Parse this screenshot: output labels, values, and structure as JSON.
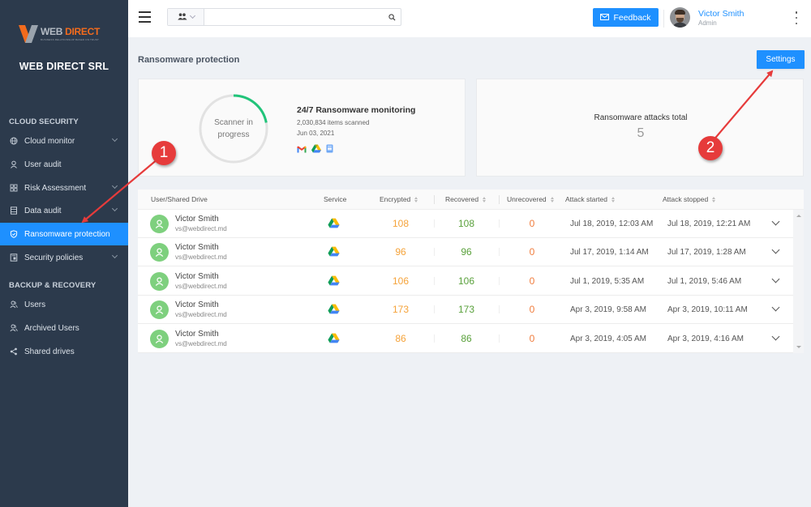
{
  "sidebar": {
    "logo": {
      "word1": "WEB ",
      "word2": "DIRECT",
      "tagline": "BUSINESS RELATIONSHIP BASED ON TRUST"
    },
    "company": "WEB DIRECT SRL",
    "sections": [
      {
        "title": "CLOUD SECURITY",
        "items": [
          {
            "label": "Cloud monitor",
            "icon": "globe-icon",
            "has_children": true
          },
          {
            "label": "User audit",
            "icon": "user-icon",
            "has_children": false
          },
          {
            "label": "Risk Assessment",
            "icon": "grid-icon",
            "has_children": true
          },
          {
            "label": "Data audit",
            "icon": "database-icon",
            "has_children": true
          },
          {
            "label": "Ransomware protection",
            "icon": "shield-icon",
            "has_children": false,
            "active": true
          },
          {
            "label": "Security policies",
            "icon": "policy-icon",
            "has_children": true
          }
        ]
      },
      {
        "title": "BACKUP & RECOVERY",
        "items": [
          {
            "label": "Users",
            "icon": "users-icon",
            "has_children": false
          },
          {
            "label": "Archived Users",
            "icon": "archived-users-icon",
            "has_children": false
          },
          {
            "label": "Shared drives",
            "icon": "share-icon",
            "has_children": false
          }
        ]
      }
    ]
  },
  "topbar": {
    "search": {
      "value": "",
      "placeholder": ""
    },
    "feedback_label": "Feedback",
    "user": {
      "name": "Victor Smith",
      "role": "Admin"
    }
  },
  "page": {
    "title": "Ransomware protection",
    "settings_label": "Settings"
  },
  "scanner": {
    "status": "Scanner in progress",
    "progress_percent": 22,
    "title": "24/7 Ransomware monitoring",
    "items_scanned": "2,030,834 items scanned",
    "date": "Jun 03, 2021",
    "services": [
      "gmail-icon",
      "google-drive-icon",
      "google-sites-icon"
    ]
  },
  "attacks": {
    "label": "Ransomware attacks total",
    "value": "5"
  },
  "table": {
    "columns": [
      "User/Shared Drive",
      "Service",
      "Encrypted",
      "Recovered",
      "Unrecovered",
      "Attack started",
      "Attack stopped"
    ],
    "rows": [
      {
        "name": "Victor Smith",
        "email": "vs@webdirect.md",
        "service": "google-drive",
        "encrypted": "108",
        "recovered": "108",
        "unrecovered": "0",
        "started": "Jul 18, 2019, 12:03 AM",
        "stopped": "Jul 18, 2019, 12:21 AM"
      },
      {
        "name": "Victor Smith",
        "email": "vs@webdirect.md",
        "service": "google-drive",
        "encrypted": "96",
        "recovered": "96",
        "unrecovered": "0",
        "started": "Jul 17, 2019, 1:14 AM",
        "stopped": "Jul 17, 2019, 1:28 AM"
      },
      {
        "name": "Victor Smith",
        "email": "vs@webdirect.md",
        "service": "google-drive",
        "encrypted": "106",
        "recovered": "106",
        "unrecovered": "0",
        "started": "Jul 1, 2019, 5:35 AM",
        "stopped": "Jul 1, 2019, 5:46 AM"
      },
      {
        "name": "Victor Smith",
        "email": "vs@webdirect.md",
        "service": "google-drive",
        "encrypted": "173",
        "recovered": "173",
        "unrecovered": "0",
        "started": "Apr 3, 2019, 9:58 AM",
        "stopped": "Apr 3, 2019, 10:11 AM"
      },
      {
        "name": "Victor Smith",
        "email": "vs@webdirect.md",
        "service": "google-drive",
        "encrypted": "86",
        "recovered": "86",
        "unrecovered": "0",
        "started": "Apr 3, 2019, 4:05 AM",
        "stopped": "Apr 3, 2019, 4:16 AM"
      }
    ]
  },
  "annotations": [
    {
      "label": "1",
      "target": "Ransomware protection menu item"
    },
    {
      "label": "2",
      "target": "Settings button"
    }
  ],
  "colors": {
    "accent": "#1e90ff",
    "sidebar_bg": "#2c3a4c",
    "encrypted": "#f5a33a",
    "recovered": "#5aa13c",
    "unrecovered": "#f07c3c",
    "progress": "#21c47a",
    "annotation": "#e63b3b"
  }
}
